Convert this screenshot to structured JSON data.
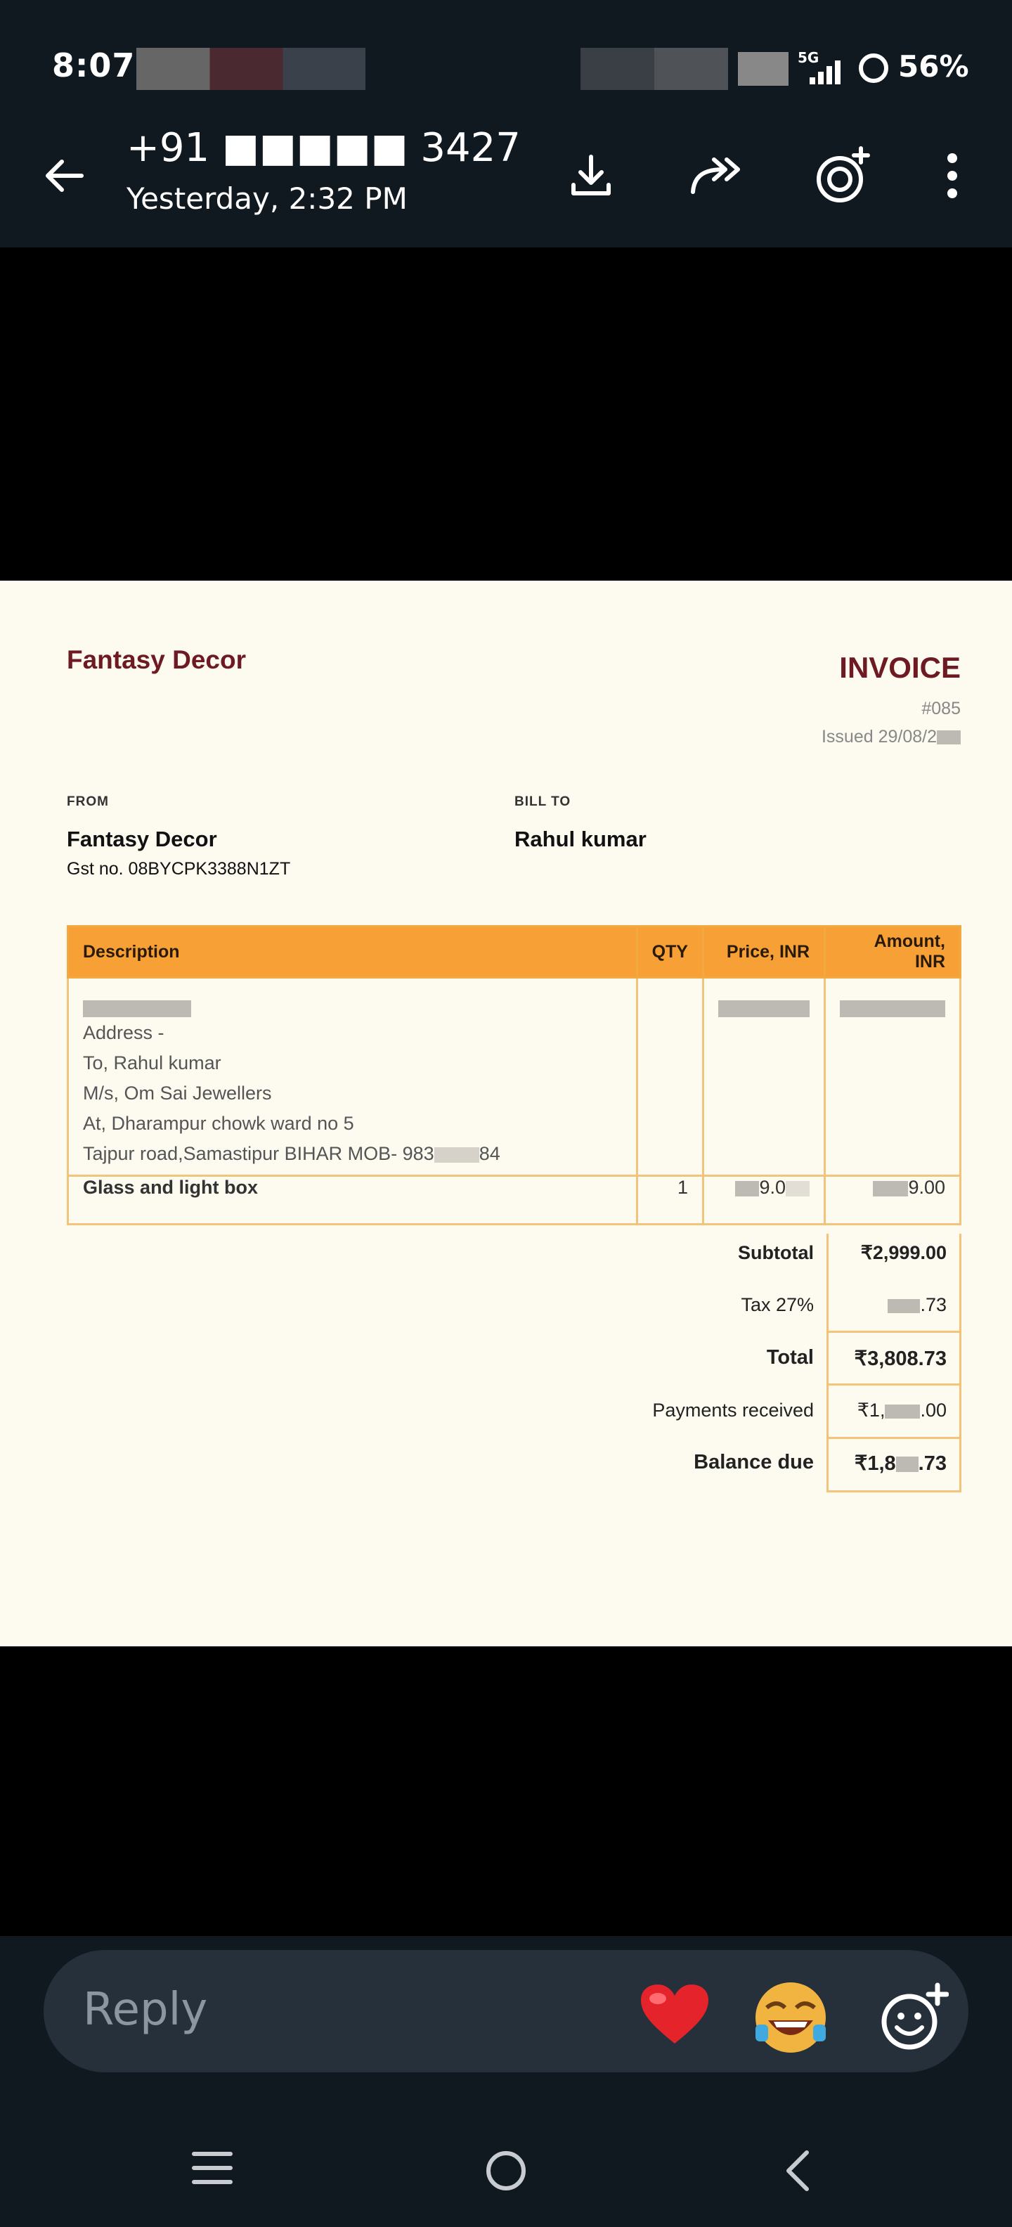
{
  "status_bar": {
    "time": "8:07",
    "network": "5G",
    "battery": "56%"
  },
  "header": {
    "title": "+91 ■■■■■ 3427",
    "subtitle": "Yesterday, 2:32 PM",
    "icons": [
      "back-arrow-icon",
      "download-icon",
      "forward-icon",
      "add-status-icon",
      "more-vert-icon"
    ]
  },
  "invoice": {
    "brand": "Fantasy Decor",
    "title": "INVOICE",
    "number": "#085",
    "issued": "Issued 29/08/2",
    "from_label": "FROM",
    "from_name": "Fantasy Decor",
    "gst": "Gst no. 08BYCPK3388N1ZT",
    "bill_to_label": "BILL TO",
    "bill_to_name": "Rahul kumar",
    "columns": [
      "Description",
      "QTY",
      "Price, INR",
      "Amount, INR"
    ],
    "row1_lines": [
      "Address -",
      "To, Rahul kumar",
      "M/s, Om Sai Jewellers",
      "At, Dharampur chowk ward no 5",
      "Tajpur road,Samastipur BIHAR MOB- 983"
    ],
    "row1_mob_suffix": "84",
    "row2": {
      "description": "Glass and light box",
      "qty": "1",
      "price": "9.0",
      "amount": "9.00"
    },
    "subtotal_label": "Subtotal",
    "subtotal_value": "₹2,999.00",
    "tax_label": "Tax 27%",
    "tax_value": ".73",
    "total_label": "Total",
    "total_value": "₹3,808.73",
    "payments_label": "Payments received",
    "payments_value_prefix": "₹1,",
    "payments_value_suffix": ".00",
    "balance_label": "Balance due",
    "balance_value_prefix": "₹1,8",
    "balance_value_suffix": ".73"
  },
  "reply": {
    "placeholder": "Reply",
    "reactions": [
      "heart-icon",
      "laughing-emoji-icon",
      "add-emoji-icon"
    ]
  },
  "nav": [
    "recents-icon",
    "home-icon",
    "back-icon"
  ]
}
